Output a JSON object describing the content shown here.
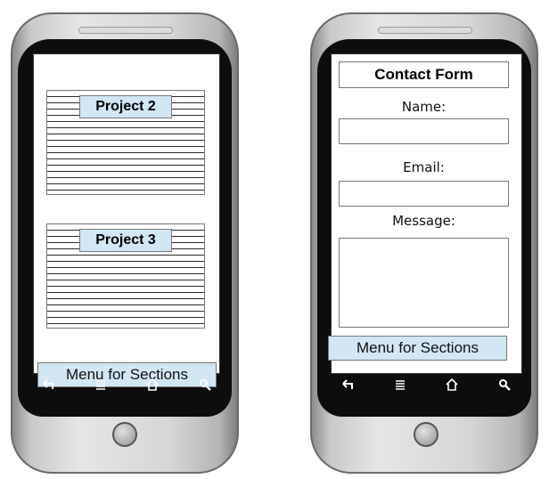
{
  "left_phone": {
    "projects": [
      {
        "title": "Project 2"
      },
      {
        "title": "Project 3"
      }
    ],
    "menu_label": "Menu for Sections"
  },
  "right_phone": {
    "form_title": "Contact Form",
    "name_label": "Name:",
    "email_label": "Email:",
    "message_label": "Message:",
    "menu_label": "Menu for Sections"
  },
  "nav_icons": [
    "back-icon",
    "menu-icon",
    "home-icon",
    "search-icon"
  ],
  "colors": {
    "label_bg": "#d2e6f4",
    "bezel": "#0d0d0d",
    "body_metal": "#d6d6d6"
  }
}
